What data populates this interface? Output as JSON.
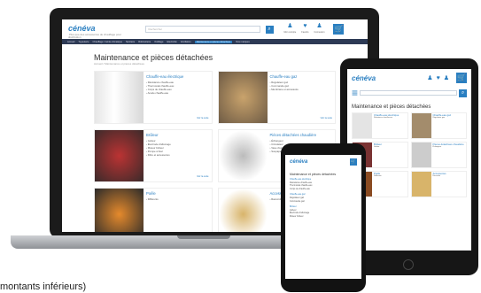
{
  "brand": {
    "name": "cénéva",
    "sub": "distribution",
    "tagline": "Plus que des accessoires de chauffage pour"
  },
  "search": {
    "placeholder": "Rechercher"
  },
  "header_icons": [
    "Mon compte",
    "Favoris",
    "Connexion"
  ],
  "nav": [
    "Accueil",
    "Tuyauterie",
    "Chauffage / Génie climatique",
    "Sanitaire",
    "Robinetterie",
    "Outillage",
    "Electricité",
    "Ventilation",
    "Maintenance et pièces détachées",
    "Nos marques"
  ],
  "page": {
    "title": "Maintenance et pièces détachées",
    "subtitle": "Accueil / Maintenance et pièces détachées",
    "more": "Voir la suite"
  },
  "categories": [
    {
      "title": "Chauffe-eau électrique",
      "items": [
        "Résistance chauffe-eau",
        "Thermostat chauffe-eau",
        "Corps de chauffe-eau",
        "Anode chauffe-eau"
      ]
    },
    {
      "title": "Chauffe-eau gaz",
      "items": [
        "Régulateur gaz",
        "Commande gaz",
        "Membrane et accessoire"
      ]
    },
    {
      "title": "Brûleur",
      "items": [
        "Gicleur",
        "Électrode d'allumage",
        "Moteur brûleur",
        "Pompe à fioul",
        "Filtre et accessoires"
      ]
    },
    {
      "title": "Pièces détachées chaudière",
      "items": [
        "Échangeur",
        "Circulateur",
        "Vase d'expansion",
        "Soupape"
      ]
    },
    {
      "title": "Poêle",
      "items": [
        "Différents"
      ]
    },
    {
      "title": "Accessoires",
      "items": [
        "Raccords"
      ]
    }
  ],
  "caption": "montants inférieurs)",
  "colors": {
    "brand": "#2a7fc1",
    "nav": "#2d3a55"
  }
}
